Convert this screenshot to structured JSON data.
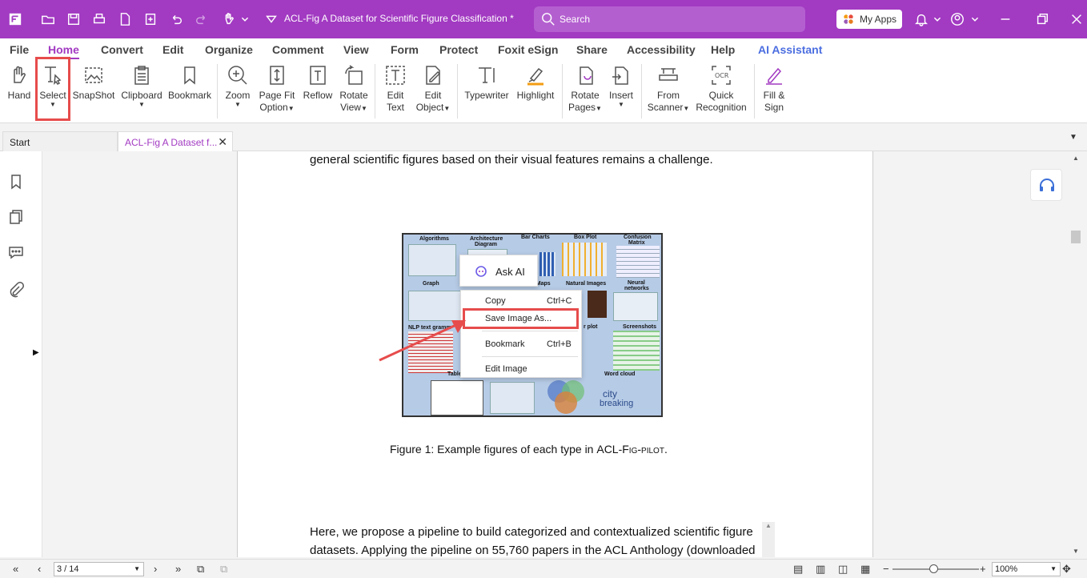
{
  "app": {
    "document_title": "ACL-Fig  A Dataset for Scientific Figure Classification *",
    "search_placeholder": "Search",
    "my_apps": "My Apps"
  },
  "menu": [
    "File",
    "Home",
    "Convert",
    "Edit",
    "Organize",
    "Comment",
    "View",
    "Form",
    "Protect",
    "Foxit eSign",
    "Share",
    "Accessibility",
    "Help",
    "AI Assistant"
  ],
  "ribbon": {
    "hand": "Hand",
    "select": "Select",
    "snapshot": "SnapShot",
    "clipboard": "Clipboard",
    "bookmark": "Bookmark",
    "zoom": "Zoom",
    "page_fit_1": "Page Fit",
    "page_fit_2": "Option",
    "reflow": "Reflow",
    "rotate_view_1": "Rotate",
    "rotate_view_2": "View",
    "edit_text_1": "Edit",
    "edit_text_2": "Text",
    "edit_object_1": "Edit",
    "edit_object_2": "Object",
    "typewriter": "Typewriter",
    "highlight": "Highlight",
    "rotate_pages_1": "Rotate",
    "rotate_pages_2": "Pages",
    "insert": "Insert",
    "from_scanner_1": "From",
    "from_scanner_2": "Scanner",
    "quick_recog_1": "Quick",
    "quick_recog_2": "Recognition",
    "fill_sign_1": "Fill &",
    "fill_sign_2": "Sign"
  },
  "tabs": [
    "Start",
    "ACL-Fig  A Dataset f..."
  ],
  "page": {
    "line_top": "general scientific figures based on their visual features remains a challenge.",
    "caption_prefix": "Figure 1: Example figures of each type in ",
    "caption_name": "ACL-Fig-pilot",
    "caption_suffix": ".",
    "para_line1": "Here, we propose a pipeline to build categorized and contextualized scientific figure",
    "para_line2": "datasets. Applying the pipeline on 55,760 papers in the ACL Anthology (downloaded"
  },
  "figure_labels": {
    "algorithms": "Algorithms",
    "architecture_1": "Architecture",
    "architecture_2": "Diagram",
    "bar_charts": "Bar Charts",
    "box_plot": "Box Plot",
    "confusion_1": "Confusion",
    "confusion_2": "Matrix",
    "graph": "Graph",
    "maps": "al Maps",
    "natural_images": "Natural Images",
    "neural_1": "Neural",
    "neural_2": "networks",
    "nlp_text": "NLP text gramm",
    "scatter": "r plot",
    "screenshots": "Screenshots",
    "table": "Table",
    "word_cloud": "Word cloud",
    "wc_city": "city",
    "wc_breaking": "breaking"
  },
  "context": {
    "ask_ai": "Ask AI",
    "copy": "Copy",
    "copy_key": "Ctrl+C",
    "save_image": "Save Image As...",
    "bookmark": "Bookmark",
    "bookmark_key": "Ctrl+B",
    "edit_image": "Edit Image"
  },
  "status": {
    "page_indicator": "3 / 14",
    "zoom": "100%"
  },
  "colors": {
    "brand": "#a23ac2",
    "highlight_red": "#e74c4c"
  }
}
